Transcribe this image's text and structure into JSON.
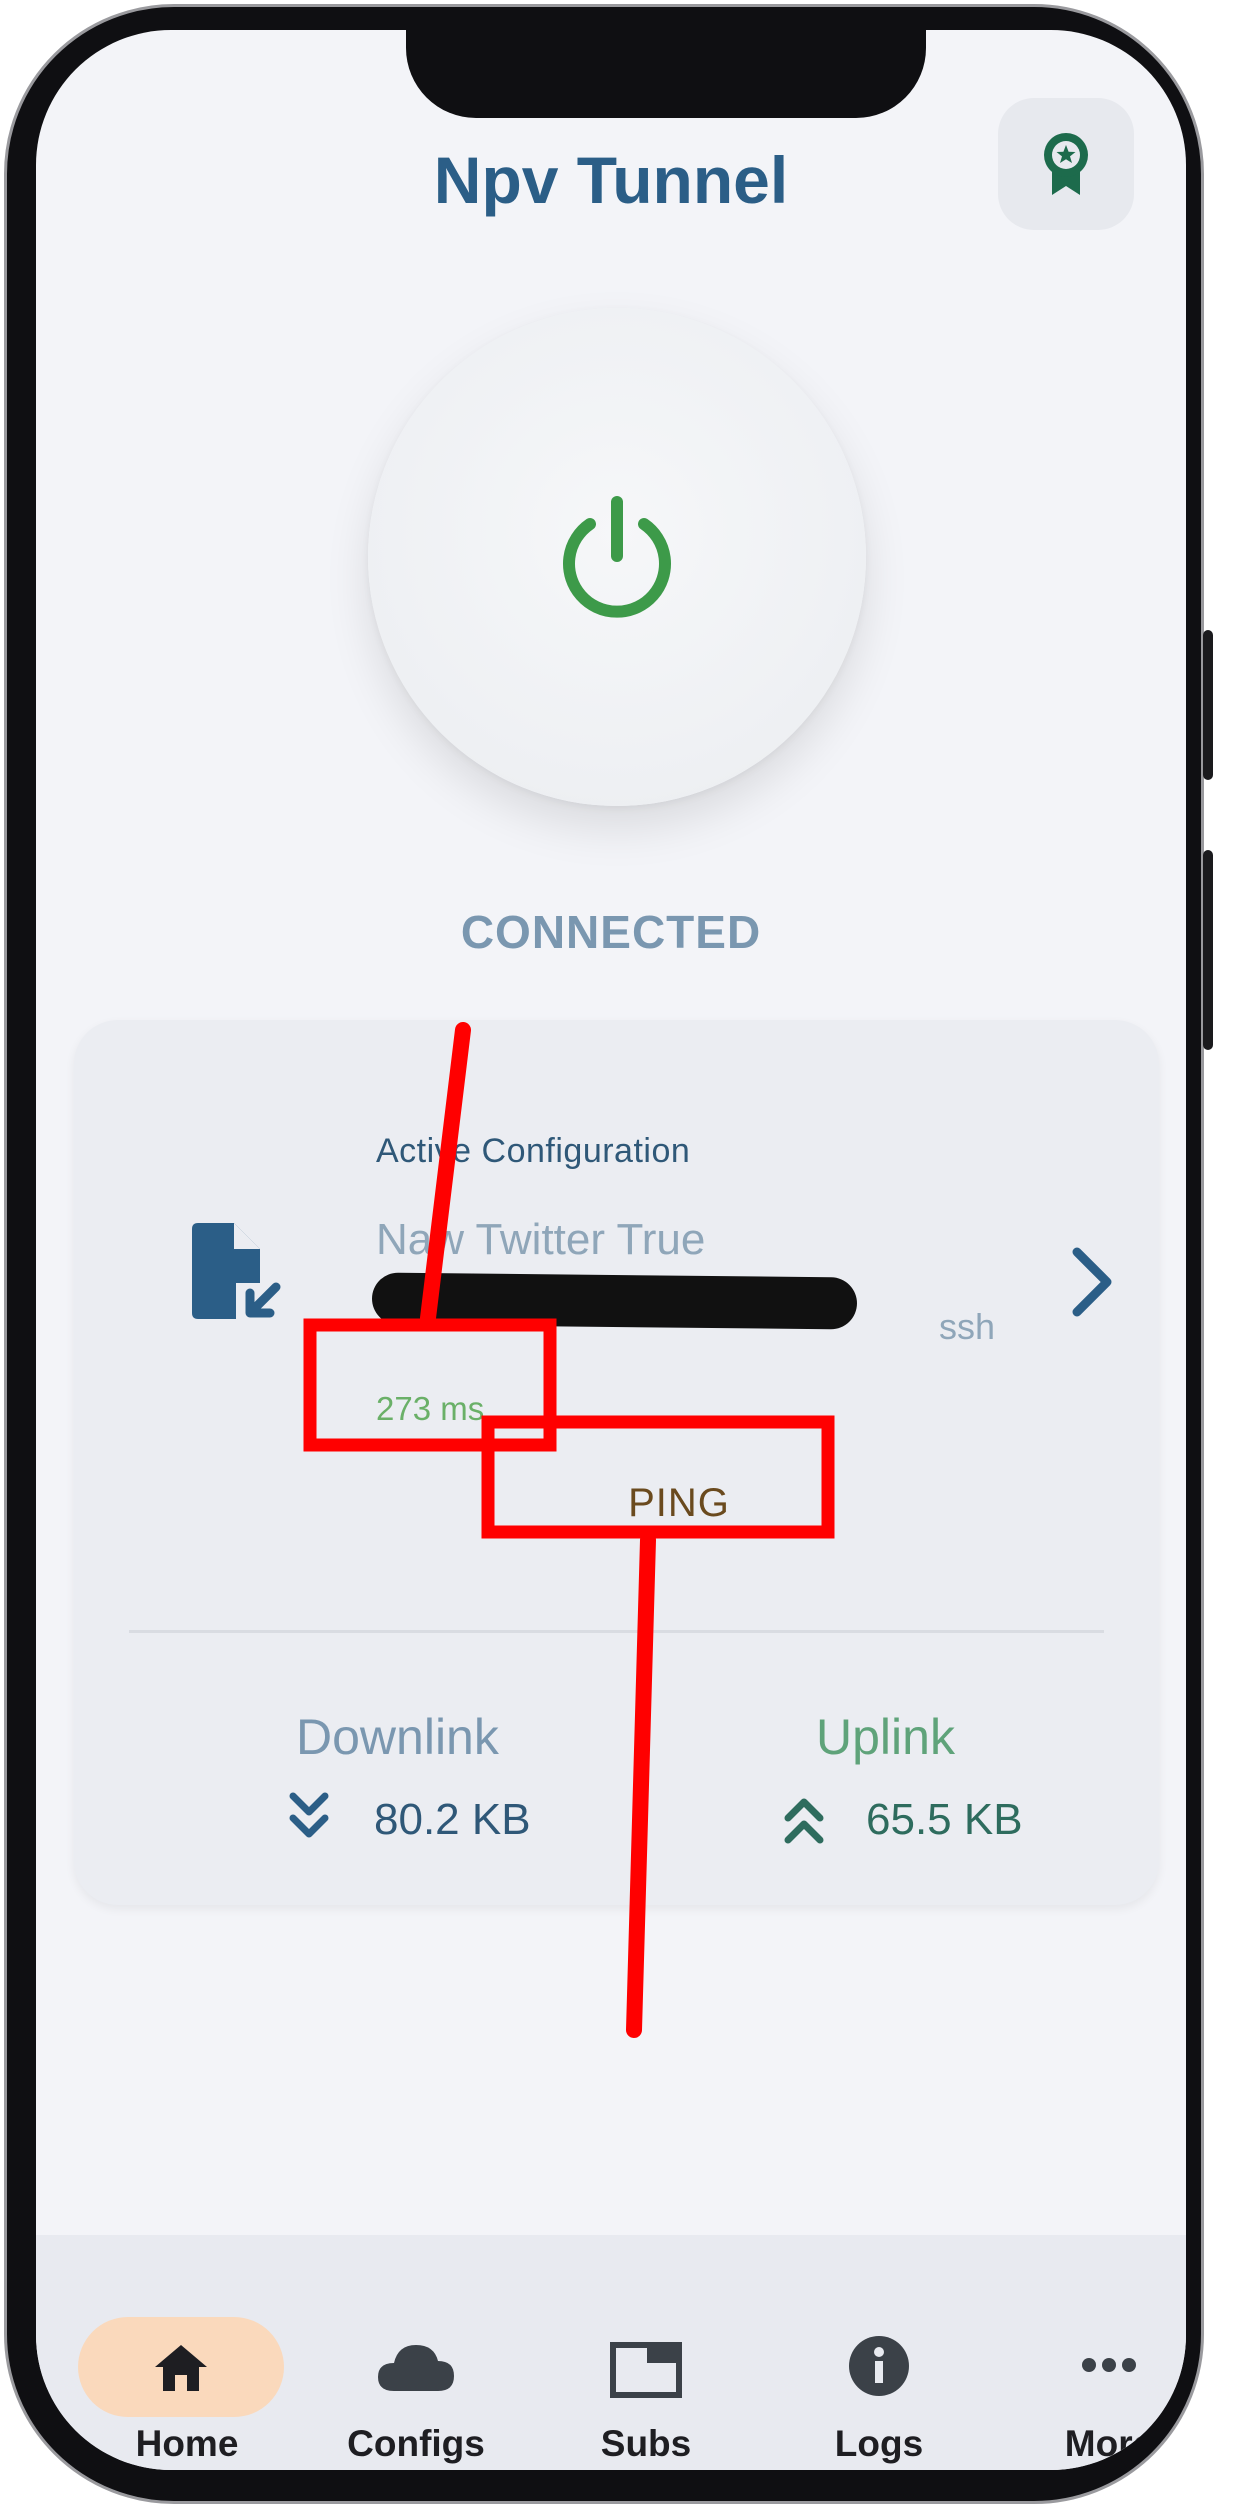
{
  "app": {
    "title": "Npv Tunnel"
  },
  "status": {
    "text": "CONNECTED"
  },
  "config": {
    "label": "Active Configuration",
    "name": "Naw Twitter True",
    "type": "ssh",
    "ping_value": "273 ms",
    "ping_button": "PING"
  },
  "stats": {
    "downlink_label": "Downlink",
    "downlink_value": "80.2 KB",
    "uplink_label": "Uplink",
    "uplink_value": "65.5 KB"
  },
  "nav": {
    "items": [
      {
        "label": "Home",
        "icon": "home-icon",
        "active": true
      },
      {
        "label": "Configs",
        "icon": "cloud-icon"
      },
      {
        "label": "Subs",
        "icon": "window-icon"
      },
      {
        "label": "Logs",
        "icon": "info-icon"
      },
      {
        "label": "More",
        "icon": "more-icon"
      }
    ]
  },
  "colors": {
    "title": "#2b5e87",
    "power_icon": "#3d9a49",
    "status": "#7a97b0",
    "ping_value": "#6ab068",
    "annotation": "#ff0000",
    "active_nav": "#fad9bc"
  }
}
